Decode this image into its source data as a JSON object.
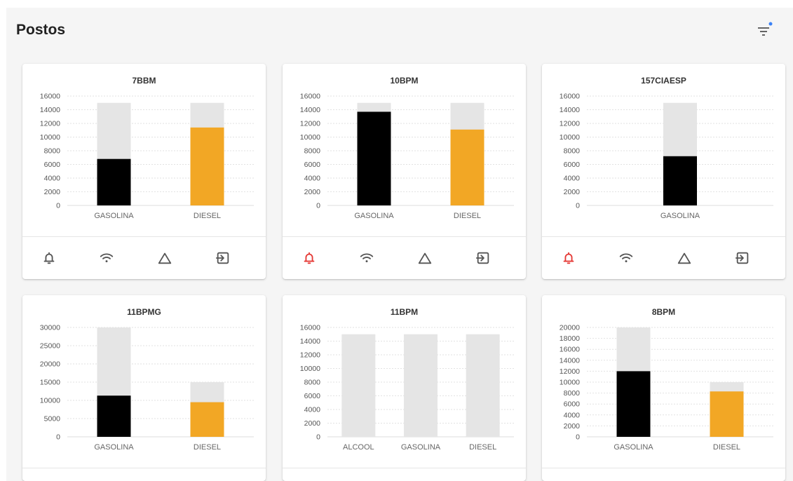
{
  "page": {
    "title": "Postos"
  },
  "colors": {
    "gasolina": "#000000",
    "diesel": "#f2a725",
    "capacity": "#e5e5e5",
    "alert": "#e53935",
    "icon": "#555555"
  },
  "icons": {
    "filter": "filter-list-icon",
    "actions": [
      "bell-icon",
      "wifi-icon",
      "triangle-icon",
      "exit-icon"
    ]
  },
  "cards": [
    {
      "title": "7BBM",
      "alarm": false,
      "chart_data": {
        "type": "bar",
        "ylim": [
          0,
          16000
        ],
        "yticks": [
          0,
          2000,
          4000,
          6000,
          8000,
          10000,
          12000,
          14000,
          16000
        ],
        "categories": [
          "GASOLINA",
          "DIESEL"
        ],
        "series": [
          {
            "values": [
              15000,
              15000
            ]
          },
          {
            "values": [
              6800,
              11400
            ]
          }
        ]
      }
    },
    {
      "title": "10BPM",
      "alarm": true,
      "chart_data": {
        "type": "bar",
        "ylim": [
          0,
          16000
        ],
        "yticks": [
          0,
          2000,
          4000,
          6000,
          8000,
          10000,
          12000,
          14000,
          16000
        ],
        "categories": [
          "GASOLINA",
          "DIESEL"
        ],
        "series": [
          {
            "values": [
              15000,
              15000
            ]
          },
          {
            "values": [
              13700,
              11100
            ]
          }
        ]
      }
    },
    {
      "title": "157CIAESP",
      "alarm": true,
      "chart_data": {
        "type": "bar",
        "ylim": [
          0,
          16000
        ],
        "yticks": [
          0,
          2000,
          4000,
          6000,
          8000,
          10000,
          12000,
          14000,
          16000
        ],
        "categories": [
          "GASOLINA"
        ],
        "series": [
          {
            "values": [
              15000
            ]
          },
          {
            "values": [
              7200
            ]
          }
        ]
      }
    },
    {
      "title": "11BPMG",
      "alarm": false,
      "chart_data": {
        "type": "bar",
        "ylim": [
          0,
          30000
        ],
        "yticks": [
          0,
          5000,
          10000,
          15000,
          20000,
          25000,
          30000
        ],
        "categories": [
          "GASOLINA",
          "DIESEL"
        ],
        "series": [
          {
            "values": [
              30000,
              15000
            ]
          },
          {
            "values": [
              11300,
              9500
            ]
          }
        ]
      }
    },
    {
      "title": "11BPM",
      "alarm": false,
      "chart_data": {
        "type": "bar",
        "ylim": [
          0,
          16000
        ],
        "yticks": [
          0,
          2000,
          4000,
          6000,
          8000,
          10000,
          12000,
          14000,
          16000
        ],
        "categories": [
          "ALCOOL",
          "GASOLINA",
          "DIESEL"
        ],
        "series": [
          {
            "values": [
              15000,
              15000,
              15000
            ]
          },
          {
            "values": [
              0,
              0,
              0
            ]
          }
        ]
      }
    },
    {
      "title": "8BPM",
      "alarm": false,
      "chart_data": {
        "type": "bar",
        "ylim": [
          0,
          20000
        ],
        "yticks": [
          0,
          2000,
          4000,
          6000,
          8000,
          10000,
          12000,
          14000,
          16000,
          18000,
          20000
        ],
        "categories": [
          "GASOLINA",
          "DIESEL"
        ],
        "series": [
          {
            "values": [
              20000,
              10000
            ]
          },
          {
            "values": [
              12000,
              8300
            ]
          }
        ]
      }
    }
  ]
}
